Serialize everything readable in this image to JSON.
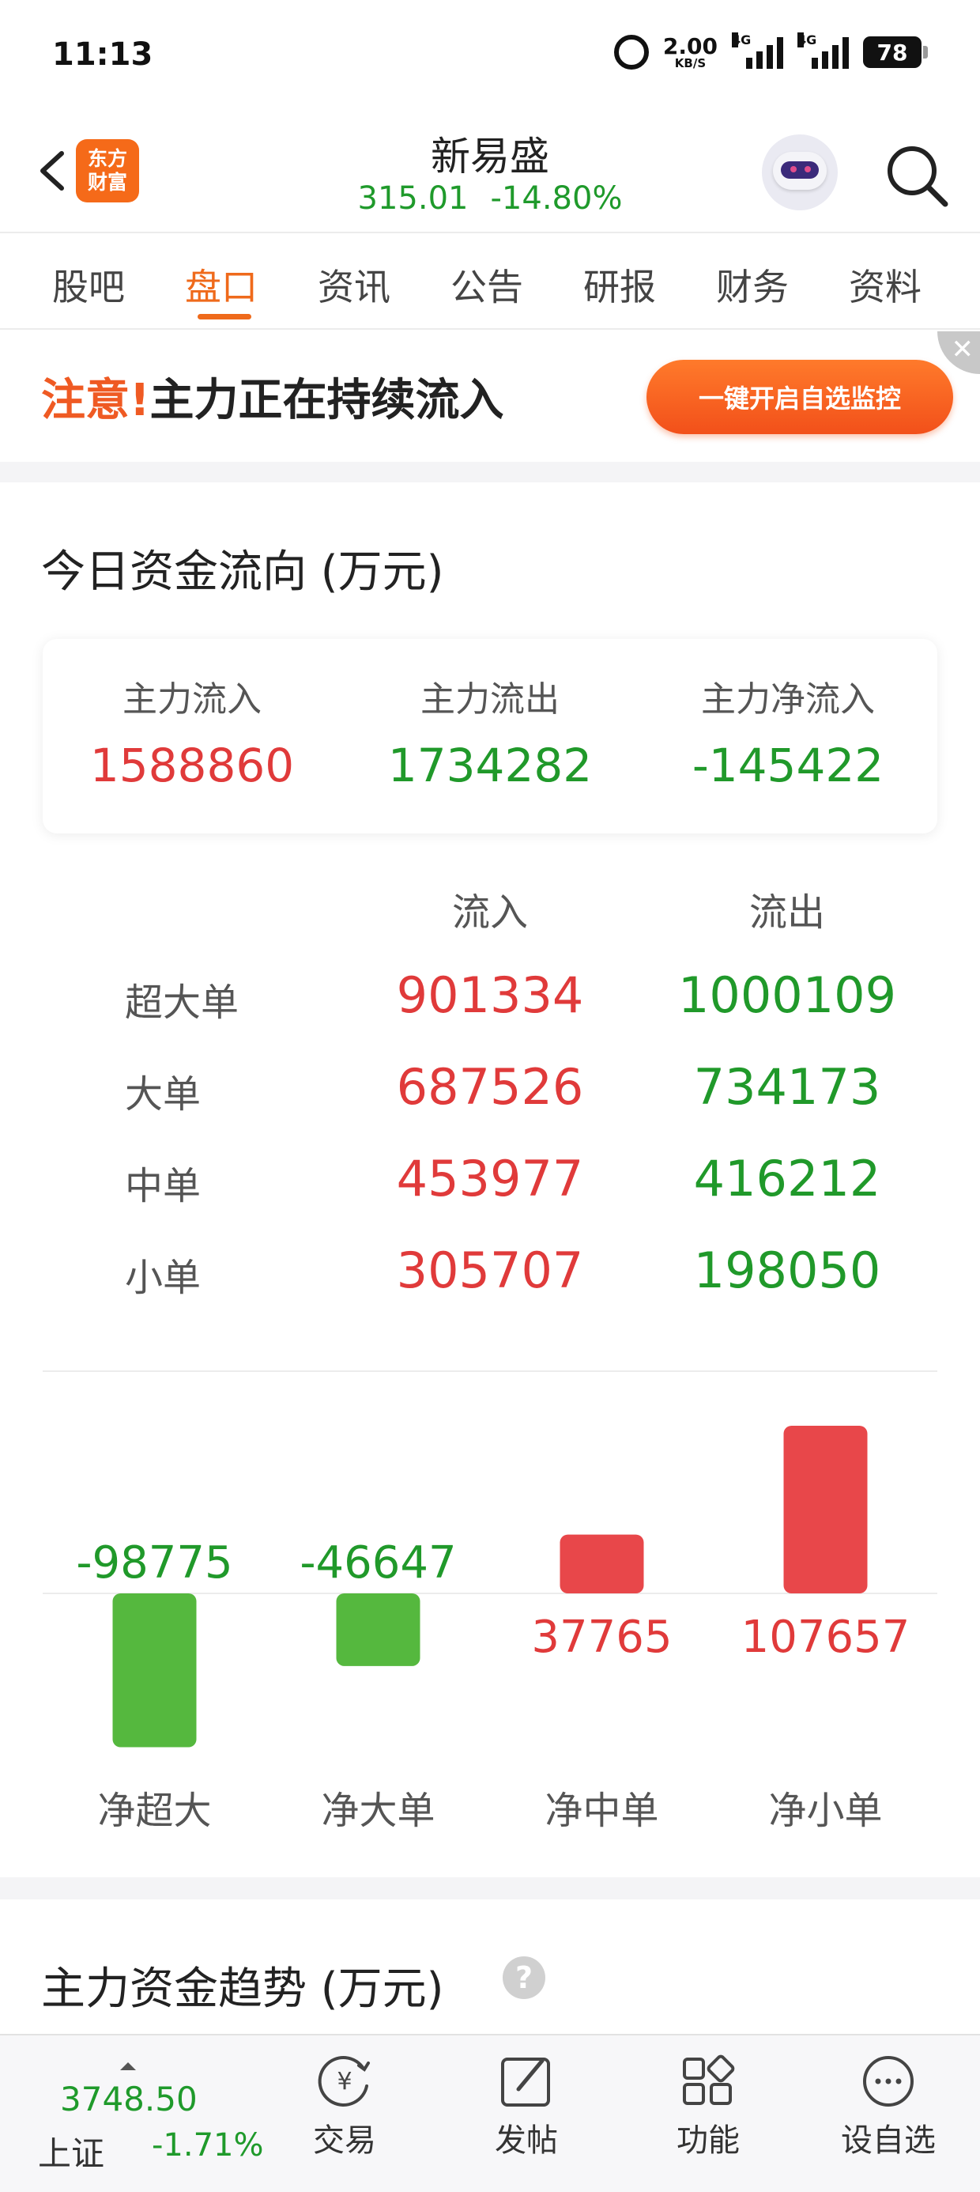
{
  "status_bar": {
    "time": "11:13",
    "net_speed": "2.00",
    "net_unit": "KB/S",
    "sig1_label": "4G",
    "sig2_label": "4G",
    "battery": "78"
  },
  "header": {
    "logo_text_line1": "东方",
    "logo_text_line2": "财富",
    "title": "新易盛",
    "price": "315.01",
    "change_pct": "-14.80%"
  },
  "tabs": [
    {
      "label": "股吧",
      "active": false
    },
    {
      "label": "盘口",
      "active": true
    },
    {
      "label": "资讯",
      "active": false
    },
    {
      "label": "公告",
      "active": false
    },
    {
      "label": "研报",
      "active": false
    },
    {
      "label": "财务",
      "active": false
    },
    {
      "label": "资料",
      "active": false
    }
  ],
  "banner": {
    "warn": "注意!",
    "text": "主力正在持续流入",
    "button": "一键开启自选监控",
    "close": "✕"
  },
  "fund_flow": {
    "title": "今日资金流向 (万元)",
    "summary": [
      {
        "label": "主力流入",
        "value": "1588860",
        "color": "red"
      },
      {
        "label": "主力流出",
        "value": "1734282",
        "color": "green"
      },
      {
        "label": "主力净流入",
        "value": "-145422",
        "color": "green"
      }
    ],
    "table_headers": {
      "inflow": "流入",
      "outflow": "流出"
    },
    "rows": [
      {
        "label": "超大单",
        "in": "901334",
        "out": "1000109"
      },
      {
        "label": "大单",
        "in": "687526",
        "out": "734173"
      },
      {
        "label": "中单",
        "in": "453977",
        "out": "416212"
      },
      {
        "label": "小单",
        "in": "305707",
        "out": "198050"
      }
    ]
  },
  "chart_data": {
    "type": "bar",
    "categories": [
      "净超大",
      "净大单",
      "净中单",
      "净小单"
    ],
    "values": [
      -98775,
      -46647,
      37765,
      107657
    ],
    "value_labels": [
      "-98775",
      "-46647",
      "37765",
      "107657"
    ],
    "colors": {
      "positive": "#e8474a",
      "negative": "#55b83e"
    }
  },
  "trend_section": {
    "title": "主力资金趋势 (万元)",
    "help": "?"
  },
  "bottom_nav": {
    "index": {
      "value": "3748.50",
      "name": "上证",
      "change": "-1.71%"
    },
    "items": [
      {
        "label": "交易",
        "icon": "trade-icon"
      },
      {
        "label": "发帖",
        "icon": "compose-icon"
      },
      {
        "label": "功能",
        "icon": "apps-icon"
      },
      {
        "label": "设自选",
        "icon": "more-icon"
      }
    ]
  }
}
